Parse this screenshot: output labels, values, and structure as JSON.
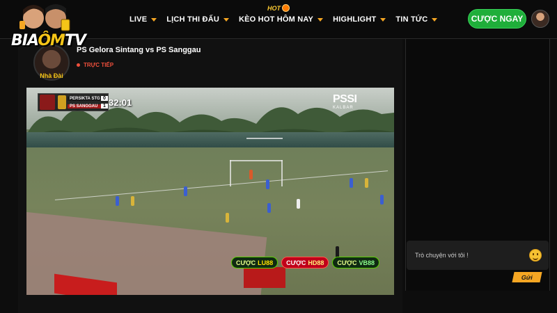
{
  "header": {
    "logo_text_part1": "BIA",
    "logo_text_part2": "ÔM",
    "logo_text_part3": "TV",
    "hot_label": "HOT",
    "nav": [
      {
        "label": "LIVE"
      },
      {
        "label": "LỊCH THI ĐẤU"
      },
      {
        "label": "KÈO HOT HÔM NAY"
      },
      {
        "label": "HIGHLIGHT"
      },
      {
        "label": "TIN TỨC"
      }
    ],
    "cta_label": "CƯỢC NGAY"
  },
  "stream": {
    "host_label": "Nhà Đài",
    "title": "PS Gelora Sintang vs PS Sanggau",
    "live_label": "TRỰC TIẾP"
  },
  "scorebug": {
    "team_a": "PERSIKTA STG",
    "team_b": "PS SANGGAU",
    "score_a": "0",
    "score_b": "1",
    "clock": "32:01"
  },
  "broadcaster": {
    "brand": "PSSI",
    "sub": "KALBAR"
  },
  "bets": [
    {
      "prefix": "CƯỢC",
      "brand": "LU88"
    },
    {
      "prefix": "CƯỢC",
      "brand": "HD88"
    },
    {
      "prefix": "CƯỢC",
      "brand": "VB88"
    }
  ],
  "chat": {
    "placeholder": "Trò chuyện với tôi !",
    "send_label": "Gửi"
  },
  "colors": {
    "accent": "#f5a623",
    "cta_green": "#1fae3a",
    "live_red": "#f0503c",
    "gold": "#f5c518"
  }
}
